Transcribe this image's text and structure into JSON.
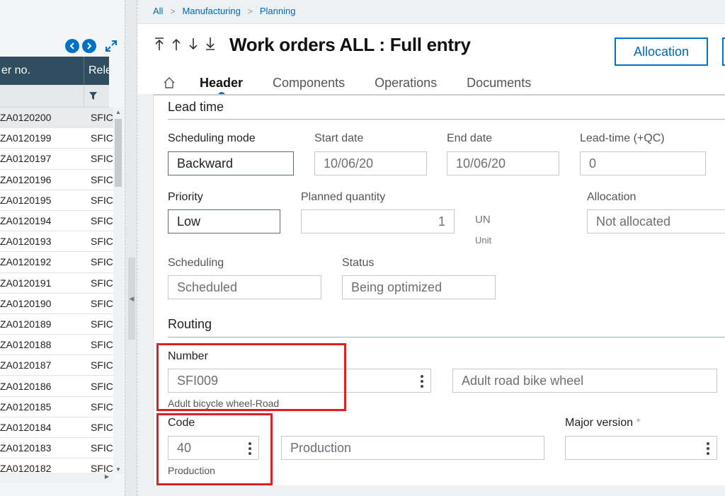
{
  "list": {
    "col_order_header": "er no.",
    "col_release_header": "Rele",
    "rows": [
      {
        "order": "ZA0120200",
        "release": "SFIC"
      },
      {
        "order": "ZA0120199",
        "release": "SFIC"
      },
      {
        "order": "ZA0120197",
        "release": "SFIC"
      },
      {
        "order": "ZA0120196",
        "release": "SFIC"
      },
      {
        "order": "ZA0120195",
        "release": "SFIC"
      },
      {
        "order": "ZA0120194",
        "release": "SFIC"
      },
      {
        "order": "ZA0120193",
        "release": "SFIC"
      },
      {
        "order": "ZA0120192",
        "release": "SFIC"
      },
      {
        "order": "ZA0120191",
        "release": "SFIC"
      },
      {
        "order": "ZA0120190",
        "release": "SFIC"
      },
      {
        "order": "ZA0120189",
        "release": "SFIC"
      },
      {
        "order": "ZA0120188",
        "release": "SFIC"
      },
      {
        "order": "ZA0120187",
        "release": "SFIC"
      },
      {
        "order": "ZA0120186",
        "release": "SFIC"
      },
      {
        "order": "ZA0120185",
        "release": "SFIC"
      },
      {
        "order": "ZA0120184",
        "release": "SFIC"
      },
      {
        "order": "ZA0120183",
        "release": "SFIC"
      },
      {
        "order": "ZA0120182",
        "release": "SFIC"
      }
    ]
  },
  "breadcrumb": [
    "All",
    "Manufacturing",
    "Planning"
  ],
  "page": {
    "title": "Work orders ALL : Full entry",
    "allocation_button": "Allocation",
    "tabs": [
      "Header",
      "Components",
      "Operations",
      "Documents"
    ]
  },
  "lead_time": {
    "section_title": "Lead time",
    "scheduling_mode_label": "Scheduling mode",
    "scheduling_mode_value": "Backward",
    "start_date_label": "Start date",
    "start_date_value": "10/06/20",
    "end_date_label": "End date",
    "end_date_value": "10/06/20",
    "lead_time_label": "Lead-time (+QC)",
    "lead_time_value": "0",
    "priority_label": "Priority",
    "priority_value": "Low",
    "planned_qty_label": "Planned quantity",
    "planned_qty_value": "1",
    "unit_code": "UN",
    "unit_label": "Unit",
    "allocation_label": "Allocation",
    "allocation_value": "Not allocated",
    "scheduling_label": "Scheduling",
    "scheduling_value": "Scheduled",
    "status_label": "Status",
    "status_value": "Being optimized"
  },
  "routing": {
    "section_title": "Routing",
    "number_label": "Number",
    "number_value": "SFI009",
    "number_hint": "Adult bicycle wheel-Road",
    "description_value": "Adult road bike wheel",
    "code_label": "Code",
    "code_value": "40",
    "code_hint": "Production",
    "code_description_value": "Production",
    "major_version_label": "Major version",
    "major_version_mandatory": "*",
    "major_version_value": ""
  },
  "colors": {
    "accent": "#0072c6",
    "list_header_bg": "#2f4f60",
    "highlight": "#e02020"
  }
}
